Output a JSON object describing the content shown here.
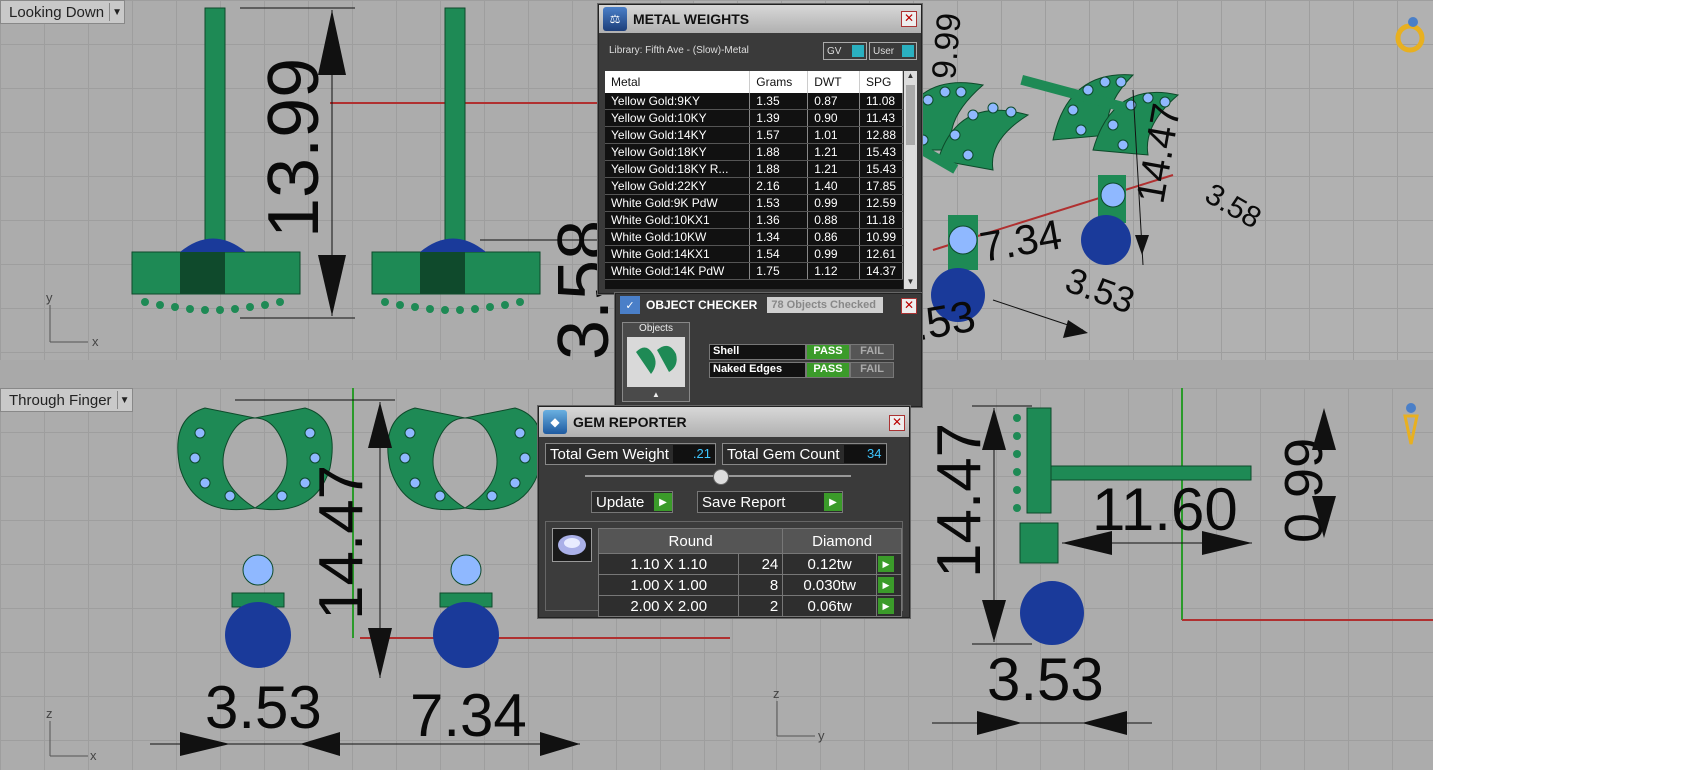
{
  "viewports": {
    "top_left": {
      "label": "Looking Down",
      "axis_y": "y",
      "axis_x": "x",
      "dims": [
        "13.99",
        "3.58"
      ]
    },
    "bottom_left": {
      "label": "Through Finger",
      "axis_y": "z",
      "axis_x": "x",
      "dims": [
        "14.47",
        "3.53",
        "7.34"
      ]
    },
    "top_right": {
      "dims": [
        "9.99",
        "14.47",
        "3.58",
        "7.34",
        "3.53",
        "3.53"
      ]
    },
    "bottom_right": {
      "axis_y": "z",
      "axis_x": "y",
      "dims": [
        "14.47",
        "11.60",
        "0.99",
        "3.53"
      ]
    }
  },
  "metal_weights": {
    "title": "METAL WEIGHTS",
    "library": "Library: Fifth Ave - (Slow)-Metal",
    "btn_gv": "GV",
    "btn_user": "User",
    "columns": [
      "Metal",
      "Grams",
      "DWT",
      "SPG"
    ],
    "rows": [
      [
        "Yellow Gold:9KY",
        "1.35",
        "0.87",
        "11.08"
      ],
      [
        "Yellow Gold:10KY",
        "1.39",
        "0.90",
        "11.43"
      ],
      [
        "Yellow Gold:14KY",
        "1.57",
        "1.01",
        "12.88"
      ],
      [
        "Yellow Gold:18KY",
        "1.88",
        "1.21",
        "15.43"
      ],
      [
        "Yellow Gold:18KY R...",
        "1.88",
        "1.21",
        "15.43"
      ],
      [
        "Yellow Gold:22KY",
        "2.16",
        "1.40",
        "17.85"
      ],
      [
        "White Gold:9K PdW",
        "1.53",
        "0.99",
        "12.59"
      ],
      [
        "White Gold:10KX1",
        "1.36",
        "0.88",
        "11.18"
      ],
      [
        "White Gold:10KW",
        "1.34",
        "0.86",
        "10.99"
      ],
      [
        "White Gold:14KX1",
        "1.54",
        "0.99",
        "12.61"
      ],
      [
        "White Gold:14K PdW",
        "1.75",
        "1.12",
        "14.37"
      ]
    ]
  },
  "object_checker": {
    "title": "OBJECT CHECKER",
    "tab2": "78 Objects Checked",
    "objects_label": "Objects",
    "checks": [
      {
        "name": "Shell",
        "pass": "PASS",
        "fail": "FAIL"
      },
      {
        "name": "Naked Edges",
        "pass": "PASS",
        "fail": "FAIL"
      }
    ]
  },
  "gem_reporter": {
    "title": "GEM REPORTER",
    "weight_label": "Total Gem Weight",
    "weight_value": ".21",
    "count_label": "Total Gem Count",
    "count_value": "34",
    "update_label": "Update",
    "save_label": "Save Report",
    "col_shape": "Round",
    "col_type": "Diamond",
    "rows": [
      [
        "1.10 X 1.10",
        "24",
        "0.12tw"
      ],
      [
        "1.00 X 1.00",
        "8",
        "0.030tw"
      ],
      [
        "2.00 X 2.00",
        "2",
        "0.06tw"
      ]
    ]
  },
  "colors": {
    "metal": "#1e8a55",
    "gem": "#8fb8ff",
    "pearl": "#1a3a9a"
  }
}
